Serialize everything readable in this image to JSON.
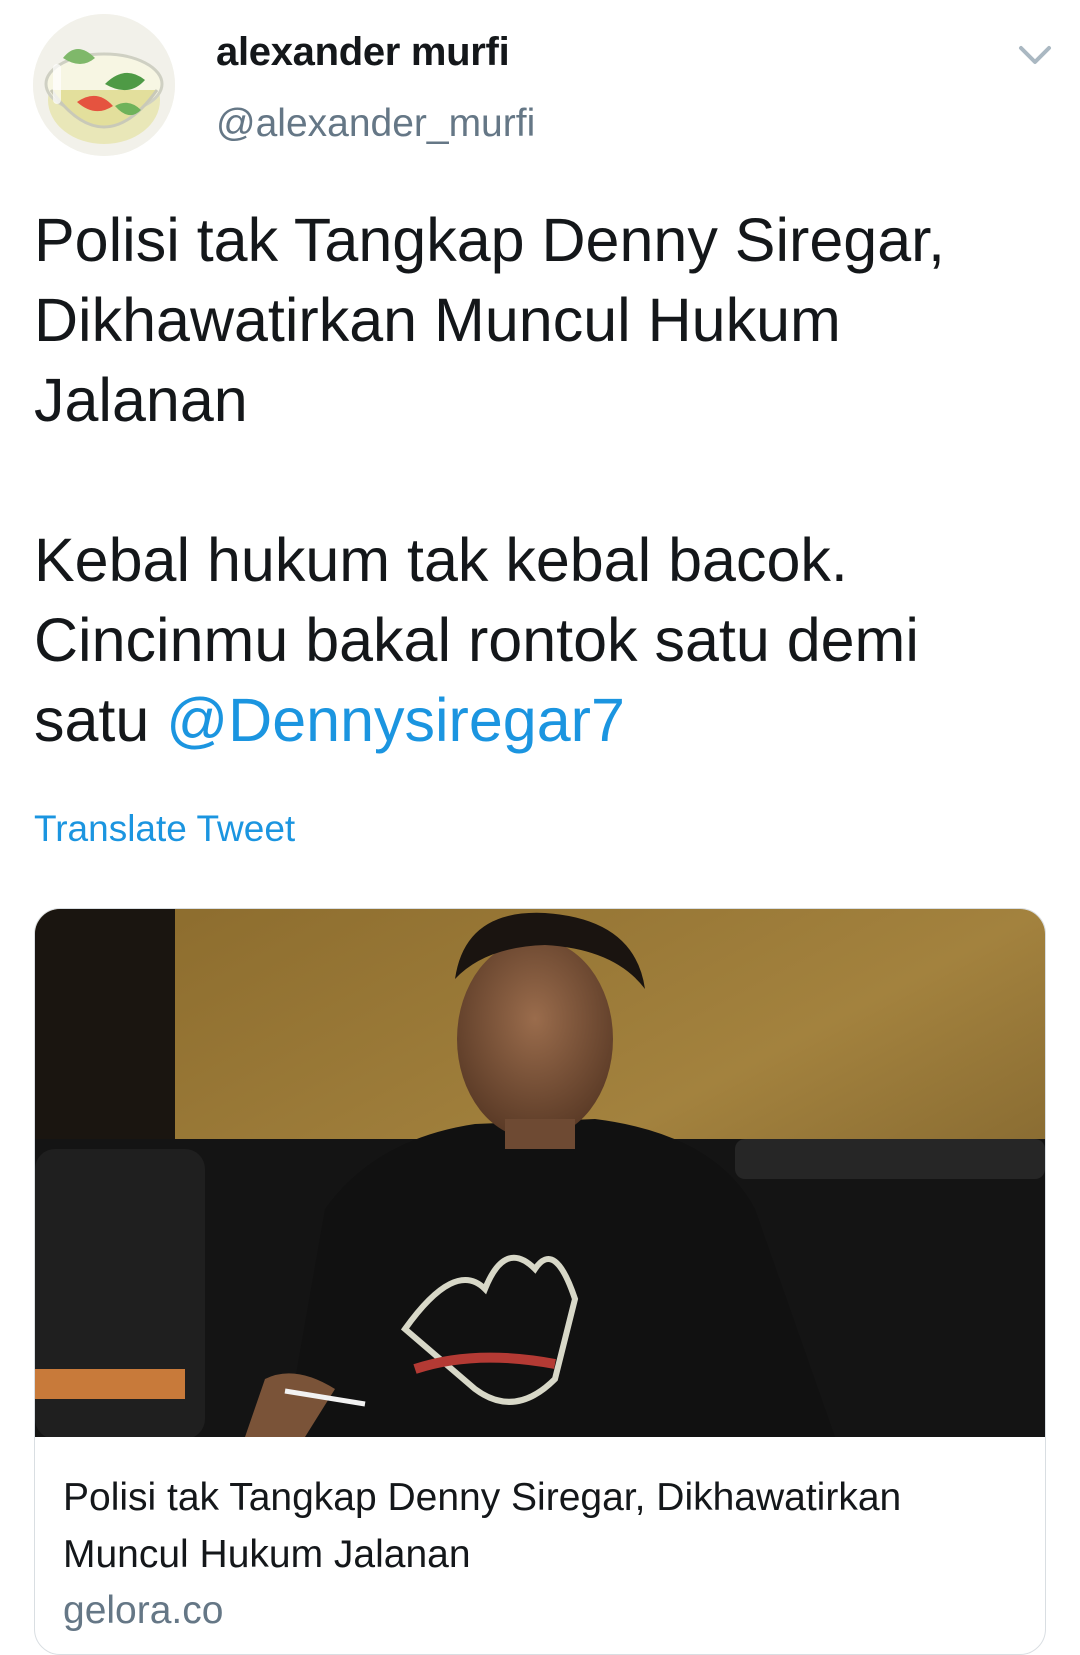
{
  "author": {
    "display_name": "alexander murfi",
    "handle": "@alexander_murfi",
    "avatar_icon": "jelly-drink-avatar-icon"
  },
  "menu": {
    "icon": "chevron-down-icon"
  },
  "tweet": {
    "paragraph1": "Polisi tak Tangkap Denny Siregar,\nDikhawatirkan Muncul Hukum\nJalanan",
    "paragraph2": "Kebal hukum tak kebal bacok.\nCincinmu bakal rontok satu demi\nsatu ",
    "mention": "@Dennysiregar7",
    "translate_label": "Translate Tweet"
  },
  "card": {
    "image_icon": "article-photo-man-smoking",
    "title": "Polisi tak Tangkap Denny Siregar, Dikhawatirkan Muncul Hukum Jalanan",
    "domain": "gelora.co"
  },
  "colors": {
    "link": "#1b95e0",
    "secondary_text": "#657786",
    "text": "#14171a",
    "border": "#d9dee2"
  }
}
